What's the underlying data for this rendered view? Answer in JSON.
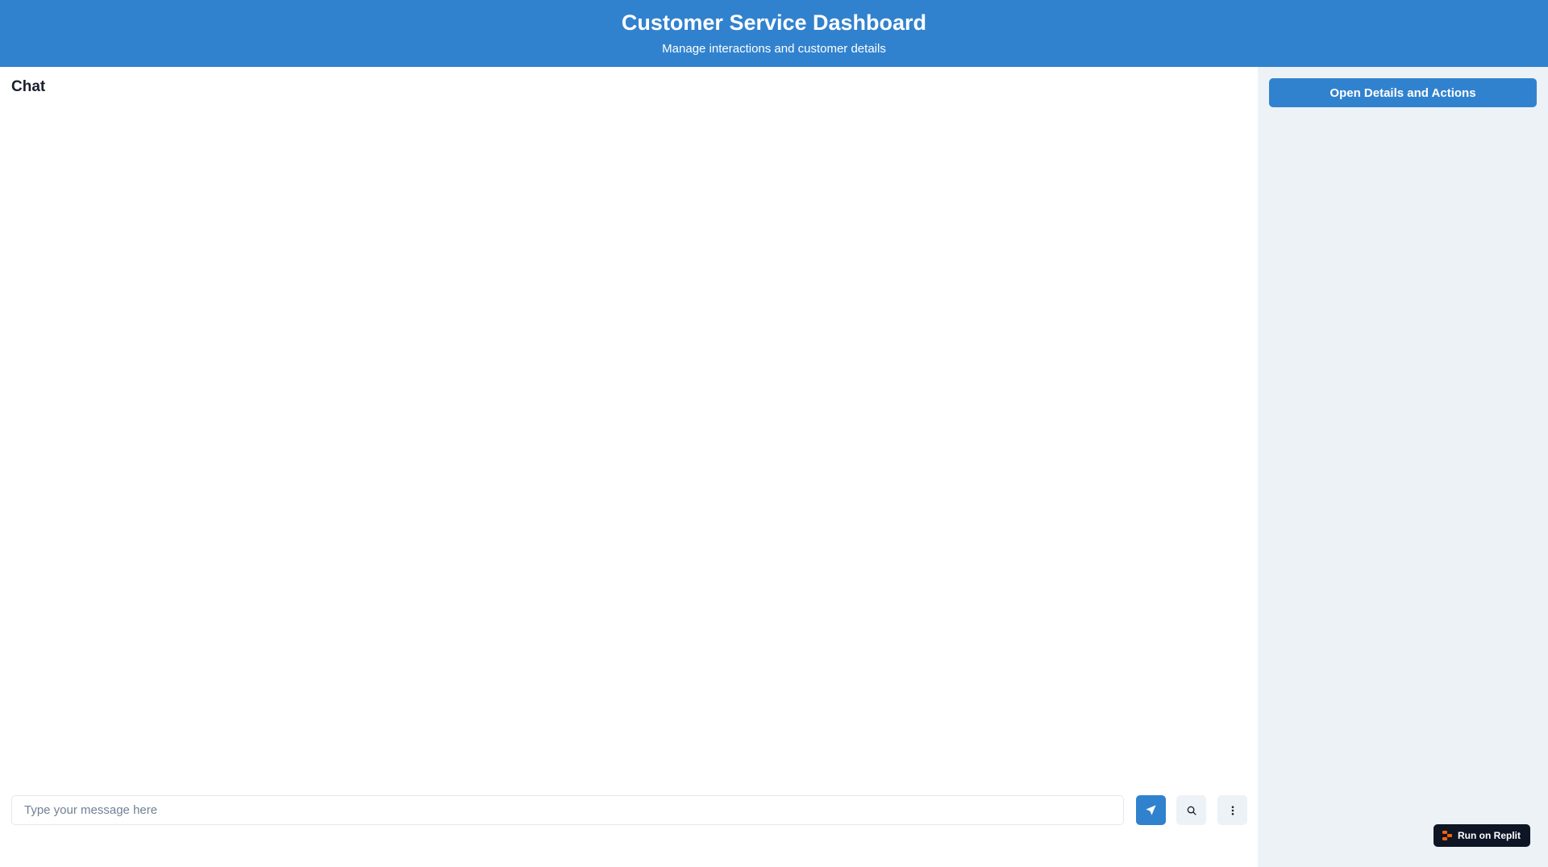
{
  "header": {
    "title": "Customer Service Dashboard",
    "subtitle": "Manage interactions and customer details"
  },
  "chat": {
    "title": "Chat",
    "input": {
      "placeholder": "Type your message here",
      "value": ""
    },
    "buttons": {
      "send_icon": "send-icon",
      "search_icon": "search-icon",
      "more_icon": "more-vertical-icon"
    }
  },
  "side_panel": {
    "open_details_label": "Open Details and Actions"
  },
  "badge": {
    "label": "Run on Replit",
    "icon": "replit-icon"
  },
  "colors": {
    "primary": "#3182ce",
    "panel_bg": "#edf2f7",
    "badge_bg": "#0e1525",
    "replit_orange": "#f26207"
  }
}
